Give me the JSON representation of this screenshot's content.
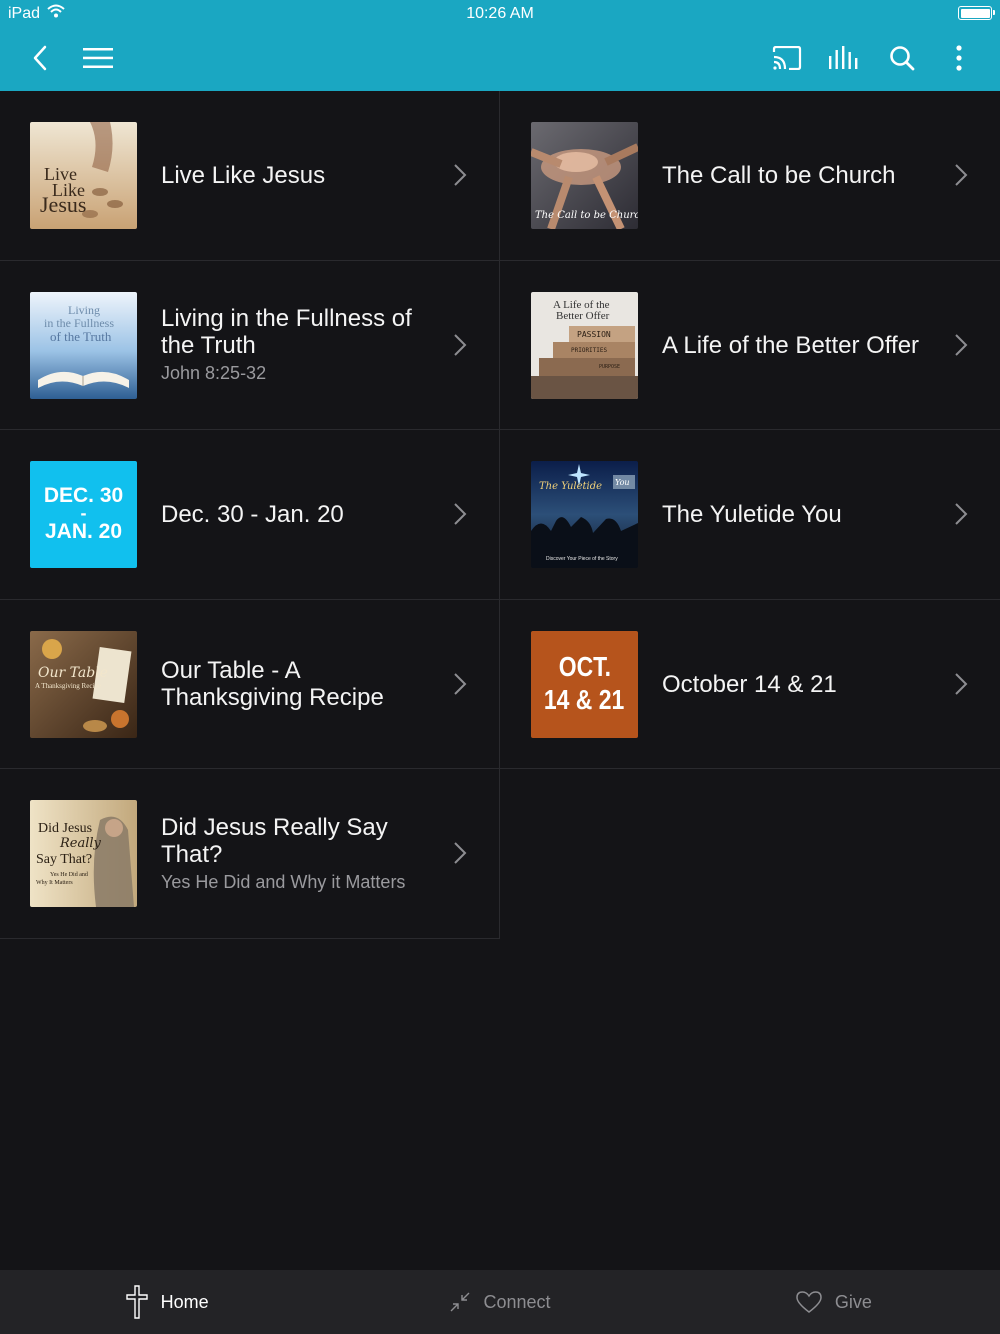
{
  "status_bar": {
    "device": "iPad",
    "time": "10:26 AM"
  },
  "colors": {
    "nav_bg": "#1aa7c2",
    "page_bg": "#141417",
    "tile_blue": "#11c0ee",
    "tile_orange": "#b6541c"
  },
  "nav": {
    "left_icons": [
      "back-chevron-icon",
      "hamburger-menu-icon"
    ],
    "right_icons": [
      "cast-icon",
      "audio-bars-icon",
      "search-icon",
      "more-vertical-icon"
    ]
  },
  "items": [
    {
      "title": "Live Like Jesus",
      "subtitle": "",
      "thumb": {
        "lines": [
          "Live",
          "Like",
          "Jesus"
        ]
      }
    },
    {
      "title": "The Call to be Church",
      "subtitle": "",
      "thumb": {
        "lines": [
          "The Call to be Church"
        ]
      }
    },
    {
      "title": "Living in the Fullness of the Truth",
      "subtitle": "John 8:25-32",
      "thumb": {
        "lines": [
          "Living",
          "in the Fullness",
          "of the Truth"
        ]
      }
    },
    {
      "title": "A Life of the Better Offer",
      "subtitle": "",
      "thumb": {
        "lines": [
          "A Life of the",
          "Better Offer",
          "PASSION",
          "PRIORITIES",
          "PURPOSE"
        ]
      }
    },
    {
      "title": "Dec. 30 - Jan. 20",
      "subtitle": "",
      "thumb": {
        "lines": [
          "DEC. 30",
          "-",
          "JAN. 20"
        ]
      }
    },
    {
      "title": "The Yuletide You",
      "subtitle": "",
      "thumb": {
        "lines": [
          "The Yuletide",
          "You",
          "Discover Your Piece of the Story"
        ]
      }
    },
    {
      "title": "Our Table - A Thanksgiving Recipe",
      "subtitle": "",
      "thumb": {
        "lines": [
          "Our Table",
          "A Thanksgiving Recipe"
        ]
      }
    },
    {
      "title": "October 14 & 21",
      "subtitle": "",
      "thumb": {
        "lines": [
          "OCT.",
          "14 & 21"
        ]
      }
    },
    {
      "title": "Did Jesus Really Say That?",
      "subtitle": "Yes He Did and Why it Matters",
      "thumb": {
        "lines": [
          "Did Jesus",
          "Really",
          "Say That?",
          "Yes He Did and",
          "Why It Matters"
        ]
      }
    }
  ],
  "tabs": [
    {
      "label": "Home",
      "icon": "cross-icon",
      "active": true
    },
    {
      "label": "Connect",
      "icon": "connect-arrows-icon",
      "active": false
    },
    {
      "label": "Give",
      "icon": "heart-icon",
      "active": false
    }
  ]
}
